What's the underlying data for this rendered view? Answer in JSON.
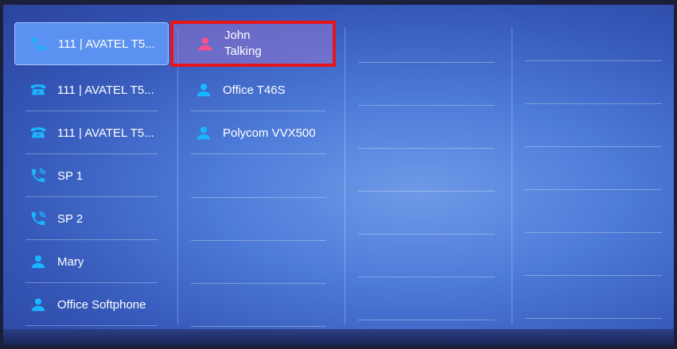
{
  "colors": {
    "icon_blue": "#19b6ff",
    "icon_pink": "#ff4f8b",
    "highlight_border": "#e8141a"
  },
  "column1": [
    {
      "label": "111 | AVATEL T5...",
      "icon": "handset-icon",
      "active": true
    },
    {
      "label": "111 | AVATEL T5...",
      "icon": "desk-phone-icon"
    },
    {
      "label": "111 | AVATEL T5...",
      "icon": "desk-phone-icon"
    },
    {
      "label": "SP 1",
      "icon": "speed-dial-icon"
    },
    {
      "label": "SP 2",
      "icon": "speed-dial-icon"
    },
    {
      "label": "Mary",
      "icon": "contact-icon"
    },
    {
      "label": "Office Softphone",
      "icon": "contact-icon"
    }
  ],
  "column2": [
    {
      "name": "John",
      "status": "Talking",
      "icon": "contact-icon",
      "state": "talking"
    },
    {
      "label": "Office T46S",
      "icon": "contact-icon"
    },
    {
      "label": "Polycom VVX500",
      "icon": "contact-icon"
    }
  ]
}
